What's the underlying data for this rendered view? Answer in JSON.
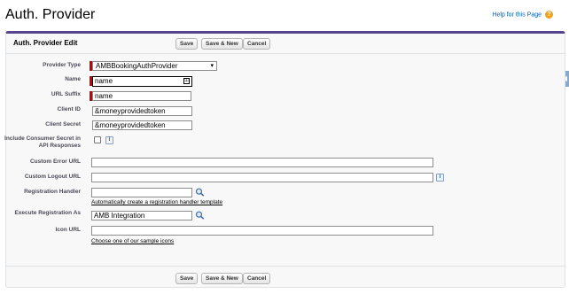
{
  "page": {
    "title": "Auth. Provider",
    "help_link": "Help for this Page",
    "help_icon": "?"
  },
  "panel": {
    "title": "Auth. Provider Edit"
  },
  "buttons": {
    "save": "Save",
    "save_new": "Save & New",
    "cancel": "Cancel"
  },
  "fields": {
    "provider_type": {
      "label": "Provider Type",
      "value": "AMBBookingAuthProvider"
    },
    "name": {
      "label": "Name",
      "value": "name"
    },
    "url_suffix": {
      "label": "URL Suffix",
      "value": "name"
    },
    "client_id": {
      "label": "Client ID",
      "value": "&moneyprovidedtoken"
    },
    "client_secret": {
      "label": "Client Secret",
      "value": "&moneyprovidedtoken"
    },
    "include_consumer_secret": {
      "label": "Include Consumer Secret in API Responses",
      "checked": false
    },
    "custom_error_url": {
      "label": "Custom Error URL",
      "value": ""
    },
    "custom_logout_url": {
      "label": "Custom Logout URL",
      "value": ""
    },
    "registration_handler": {
      "label": "Registration Handler",
      "value": "",
      "link": "Automatically create a registration handler template"
    },
    "execute_registration_as": {
      "label": "Execute Registration As",
      "value": "AMB Integration"
    },
    "icon_url": {
      "label": "Icon URL",
      "value": "",
      "link": "Choose one of our sample icons"
    }
  },
  "icons": {
    "info": "i",
    "key": "⚿",
    "side_tab": "◀",
    "caret": "▾"
  },
  "colors": {
    "accent": "#56458c",
    "required": "#cc0000",
    "link": "#015ba7"
  }
}
